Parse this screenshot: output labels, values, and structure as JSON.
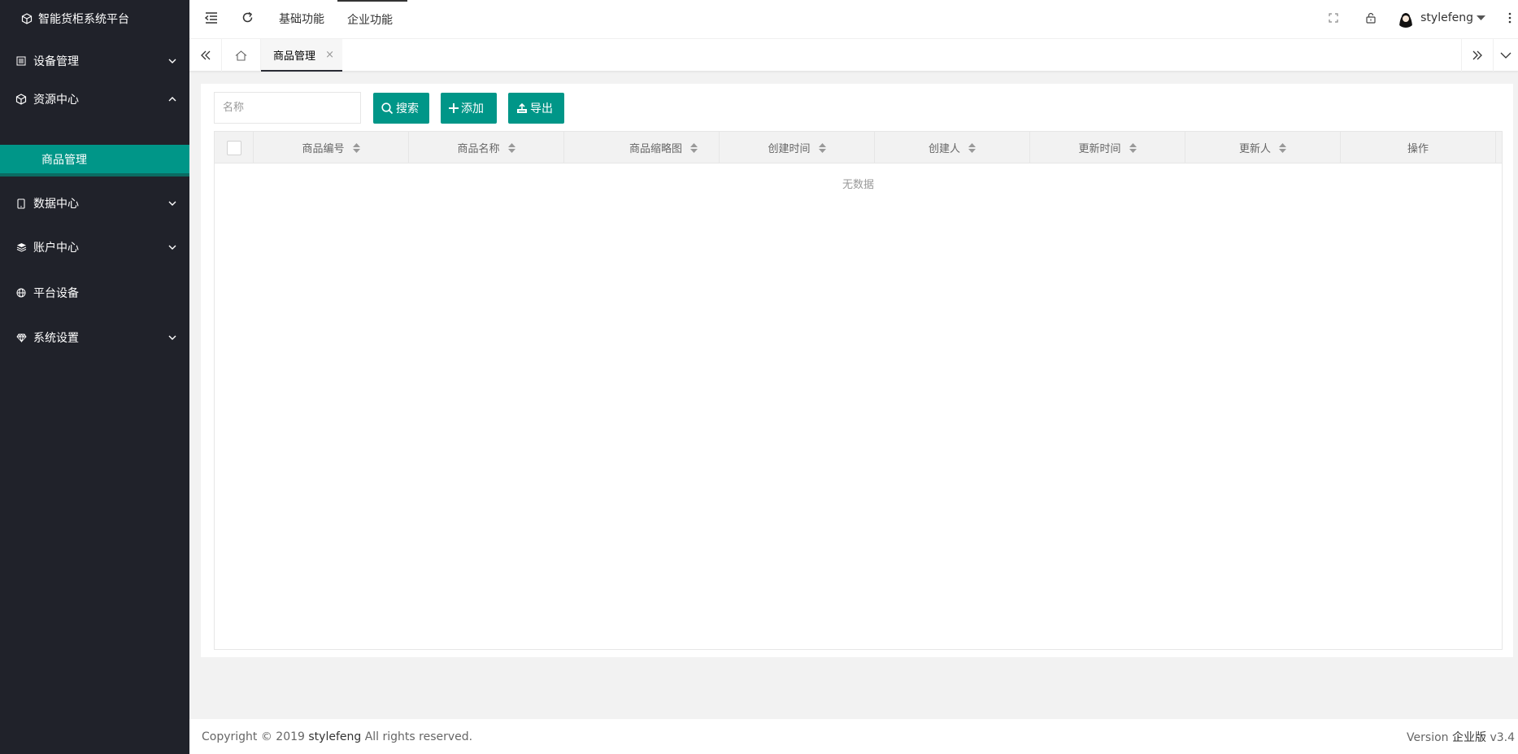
{
  "app": {
    "title": "智能货柜系统平台"
  },
  "sidebar": {
    "items": [
      {
        "label": "设备管理",
        "icon": "list-icon"
      },
      {
        "label": "资源中心",
        "icon": "cube-icon"
      },
      {
        "label": "数据中心",
        "icon": "tablet-icon"
      },
      {
        "label": "账户中心",
        "icon": "layers-icon"
      },
      {
        "label": "平台设备",
        "icon": "globe-icon"
      },
      {
        "label": "系统设置",
        "icon": "diamond-icon"
      }
    ],
    "submenu": {
      "label": "商品管理"
    }
  },
  "header": {
    "tabs": [
      "基础功能",
      "企业功能"
    ],
    "user": "stylefeng"
  },
  "tabsbar": {
    "active_tab": "商品管理",
    "close": "×"
  },
  "toolbar": {
    "search_placeholder": "名称",
    "search_label": "搜索",
    "add_label": "添加",
    "export_label": "导出"
  },
  "table": {
    "columns": [
      "商品编号",
      "商品名称",
      "商品缩略图",
      "创建时间",
      "创建人",
      "更新时间",
      "更新人",
      "操作"
    ],
    "rows": [],
    "empty_text": "无数据"
  },
  "footer": {
    "copyright_prefix": "Copyright © 2019",
    "copyright_owner": "stylefeng",
    "copyright_suffix": "All rights reserved.",
    "version_prefix": "Version",
    "version_edition": "企业版",
    "version_number": "v3.4"
  },
  "colors": {
    "accent": "#009688",
    "sidebar_bg": "#20222a"
  }
}
